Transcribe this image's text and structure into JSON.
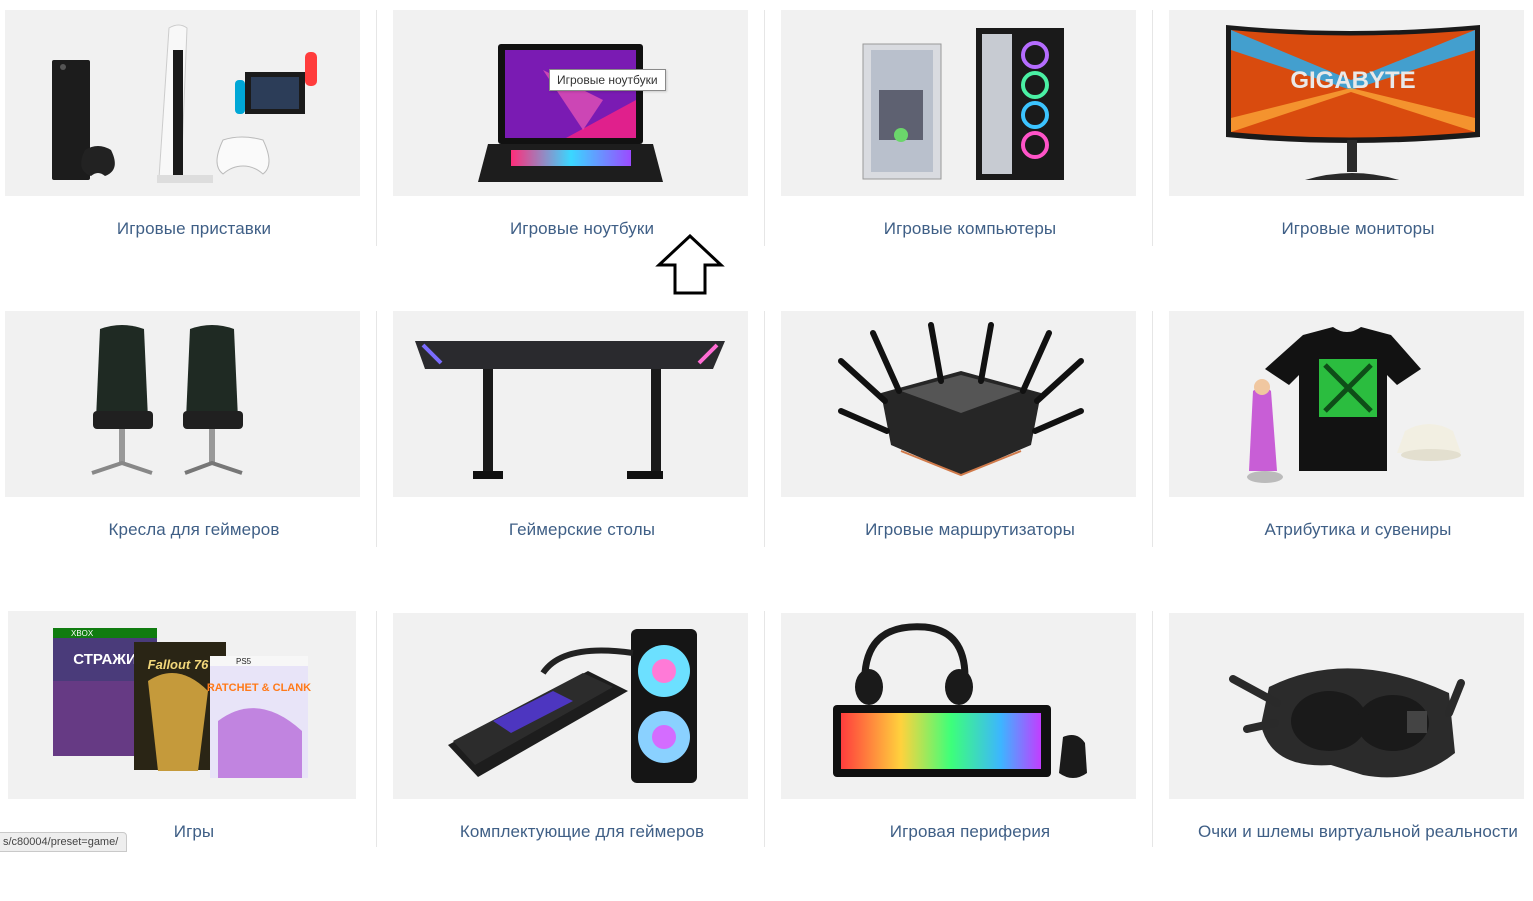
{
  "categories": [
    {
      "label": "Игровые приставки",
      "icon": "game-consoles-image"
    },
    {
      "label": "Игровые ноутбуки",
      "icon": "gaming-laptop-image"
    },
    {
      "label": "Игровые компьютеры",
      "icon": "gaming-pc-image"
    },
    {
      "label": "Игровые мониторы",
      "icon": "gaming-monitor-image"
    },
    {
      "label": "Кресла для геймеров",
      "icon": "gaming-chairs-image"
    },
    {
      "label": "Геймерские столы",
      "icon": "gaming-desk-image"
    },
    {
      "label": "Игровые маршрутизаторы",
      "icon": "gaming-router-image"
    },
    {
      "label": "Атрибутика и сувениры",
      "icon": "merch-souvenirs-image"
    },
    {
      "label": "Игры",
      "icon": "games-boxes-image"
    },
    {
      "label": "Комплектующие для геймеров",
      "icon": "gpu-components-image"
    },
    {
      "label": "Игровая периферия",
      "icon": "peripherals-image"
    },
    {
      "label": "Очки и шлемы виртуальной реальности",
      "icon": "vr-headset-image"
    }
  ],
  "tooltip": "Игровые ноутбуки",
  "status_url": "s/c80004/preset=game/",
  "brand_text": {
    "monitor": "GIGABYTE",
    "game1_platform": "XBOX",
    "game1_title": "СТРАЖИ",
    "game2_title": "Fallout 76",
    "game3_platform": "PS5",
    "game3_title": "RATCHET & CLANK"
  },
  "colors": {
    "label": "#3f5f86",
    "tile_bg": "#f1f1f1"
  }
}
